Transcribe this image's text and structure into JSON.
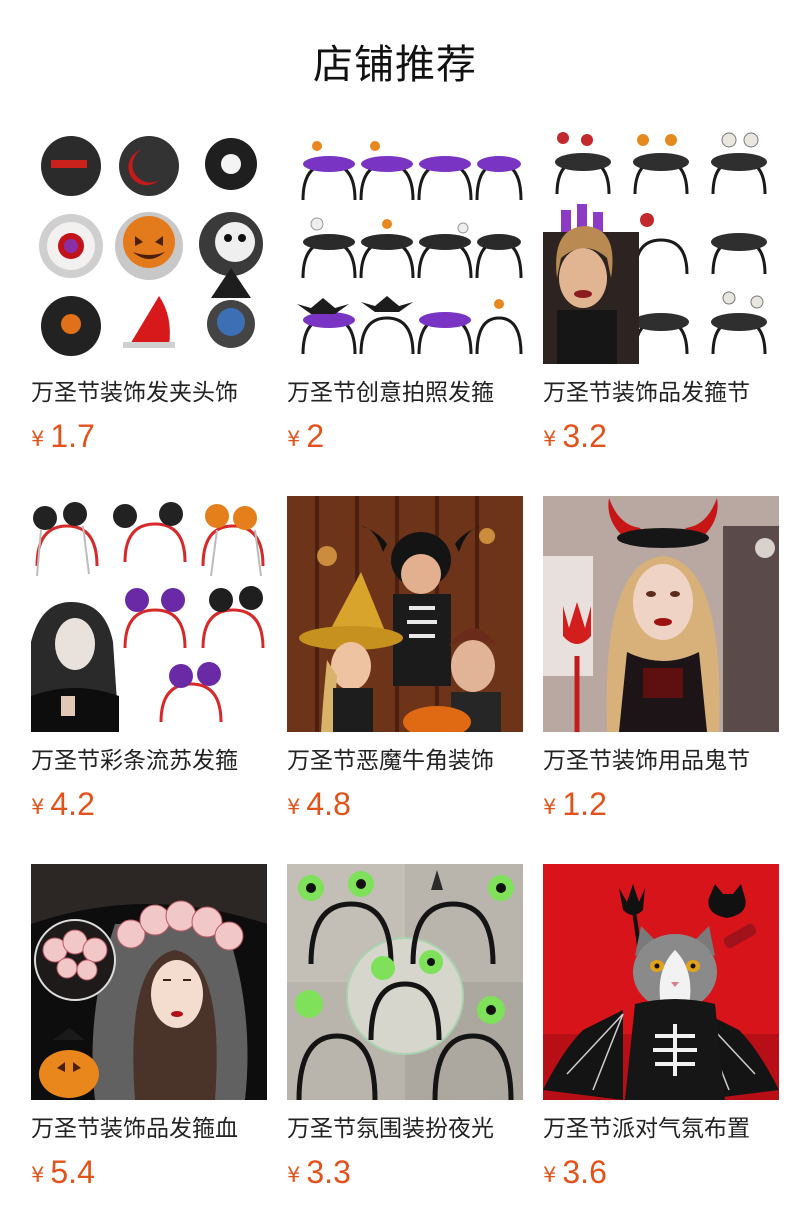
{
  "header": {
    "title": "店铺推荐"
  },
  "products": [
    {
      "name": "万圣节装饰发夹头饰",
      "currency": "¥",
      "price": "1.7",
      "image": "halloween-hair-clips"
    },
    {
      "name": "万圣节创意拍照发箍",
      "currency": "¥",
      "price": "2",
      "image": "purple-feather-headbands"
    },
    {
      "name": "万圣节装饰品发箍节",
      "currency": "¥",
      "price": "3.2",
      "image": "skeleton-headbands-model"
    },
    {
      "name": "万圣节彩条流苏发箍",
      "currency": "¥",
      "price": "4.2",
      "image": "tassel-headbands-model"
    },
    {
      "name": "万圣节恶魔牛角装饰",
      "currency": "¥",
      "price": "4.8",
      "image": "kids-costume-party"
    },
    {
      "name": "万圣节装饰用品鬼节",
      "currency": "¥",
      "price": "1.2",
      "image": "devil-horns-woman"
    },
    {
      "name": "万圣节装饰品发箍血",
      "currency": "¥",
      "price": "5.4",
      "image": "bloody-flower-crown"
    },
    {
      "name": "万圣节氛围装扮夜光",
      "currency": "¥",
      "price": "3.3",
      "image": "glowing-headbands"
    },
    {
      "name": "万圣节派对气氛布置",
      "currency": "¥",
      "price": "3.6",
      "image": "cat-bat-costume"
    }
  ]
}
